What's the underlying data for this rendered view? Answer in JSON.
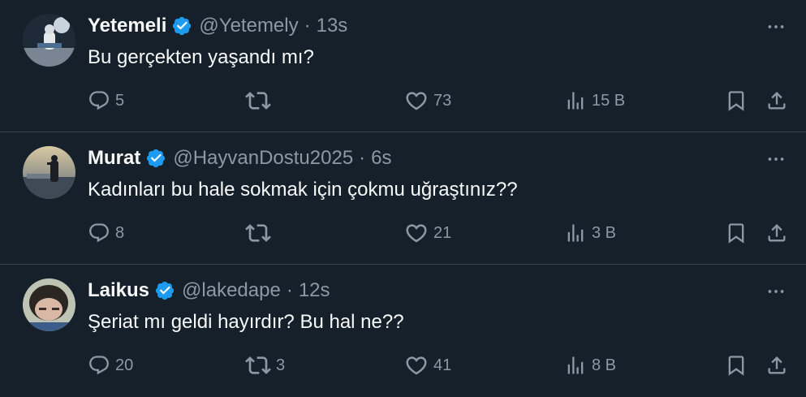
{
  "colors": {
    "background": "#15202b",
    "divider": "#38444d",
    "text_primary": "#f7f9f9",
    "text_secondary": "#8b98a5",
    "verified": "#1d9bf0"
  },
  "icons": {
    "verified": "verified-badge-icon",
    "more": "more-icon",
    "reply": "reply-icon",
    "retweet": "retweet-icon",
    "like": "heart-icon",
    "views": "views-icon",
    "bookmark": "bookmark-icon",
    "share": "share-icon"
  },
  "tweets": [
    {
      "name": "Yetemeli",
      "handle": "@Yetemely",
      "separator": "·",
      "time": "13s",
      "text": "Bu gerçekten yaşandı mı?",
      "replies": "5",
      "retweets": "",
      "likes": "73",
      "views": "15 B"
    },
    {
      "name": "Murat",
      "handle": "@HayvanDostu2025",
      "separator": "·",
      "time": "6s",
      "text": "Kadınları bu hale sokmak için çokmu uğraştınız??",
      "replies": "8",
      "retweets": "",
      "likes": "21",
      "views": "3 B"
    },
    {
      "name": "Laikus",
      "handle": "@lakedape",
      "separator": "·",
      "time": "12s",
      "text": "Şeriat mı geldi hayırdır? Bu hal ne??",
      "replies": "20",
      "retweets": "3",
      "likes": "41",
      "views": "8 B"
    }
  ]
}
